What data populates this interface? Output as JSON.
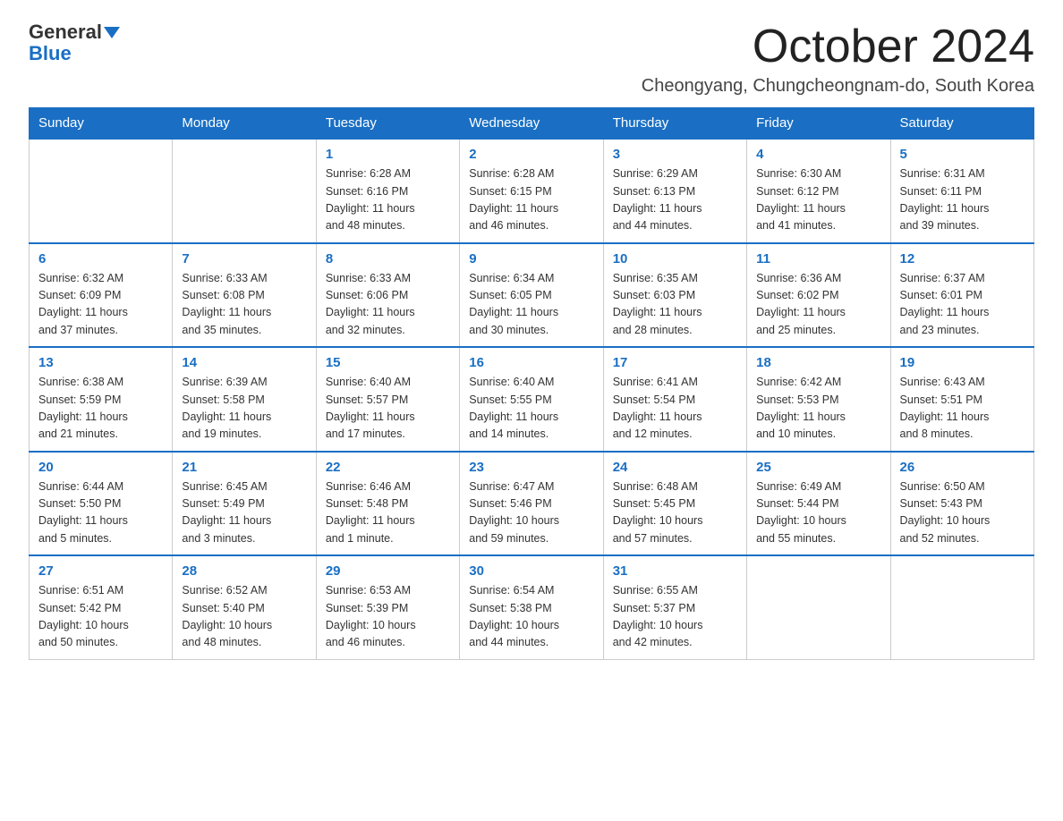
{
  "header": {
    "logo_general": "General",
    "logo_blue": "Blue",
    "month_title": "October 2024",
    "location": "Cheongyang, Chungcheongnam-do, South Korea"
  },
  "days_of_week": [
    "Sunday",
    "Monday",
    "Tuesday",
    "Wednesday",
    "Thursday",
    "Friday",
    "Saturday"
  ],
  "weeks": [
    [
      {
        "day": "",
        "info": ""
      },
      {
        "day": "",
        "info": ""
      },
      {
        "day": "1",
        "info": "Sunrise: 6:28 AM\nSunset: 6:16 PM\nDaylight: 11 hours\nand 48 minutes."
      },
      {
        "day": "2",
        "info": "Sunrise: 6:28 AM\nSunset: 6:15 PM\nDaylight: 11 hours\nand 46 minutes."
      },
      {
        "day": "3",
        "info": "Sunrise: 6:29 AM\nSunset: 6:13 PM\nDaylight: 11 hours\nand 44 minutes."
      },
      {
        "day": "4",
        "info": "Sunrise: 6:30 AM\nSunset: 6:12 PM\nDaylight: 11 hours\nand 41 minutes."
      },
      {
        "day": "5",
        "info": "Sunrise: 6:31 AM\nSunset: 6:11 PM\nDaylight: 11 hours\nand 39 minutes."
      }
    ],
    [
      {
        "day": "6",
        "info": "Sunrise: 6:32 AM\nSunset: 6:09 PM\nDaylight: 11 hours\nand 37 minutes."
      },
      {
        "day": "7",
        "info": "Sunrise: 6:33 AM\nSunset: 6:08 PM\nDaylight: 11 hours\nand 35 minutes."
      },
      {
        "day": "8",
        "info": "Sunrise: 6:33 AM\nSunset: 6:06 PM\nDaylight: 11 hours\nand 32 minutes."
      },
      {
        "day": "9",
        "info": "Sunrise: 6:34 AM\nSunset: 6:05 PM\nDaylight: 11 hours\nand 30 minutes."
      },
      {
        "day": "10",
        "info": "Sunrise: 6:35 AM\nSunset: 6:03 PM\nDaylight: 11 hours\nand 28 minutes."
      },
      {
        "day": "11",
        "info": "Sunrise: 6:36 AM\nSunset: 6:02 PM\nDaylight: 11 hours\nand 25 minutes."
      },
      {
        "day": "12",
        "info": "Sunrise: 6:37 AM\nSunset: 6:01 PM\nDaylight: 11 hours\nand 23 minutes."
      }
    ],
    [
      {
        "day": "13",
        "info": "Sunrise: 6:38 AM\nSunset: 5:59 PM\nDaylight: 11 hours\nand 21 minutes."
      },
      {
        "day": "14",
        "info": "Sunrise: 6:39 AM\nSunset: 5:58 PM\nDaylight: 11 hours\nand 19 minutes."
      },
      {
        "day": "15",
        "info": "Sunrise: 6:40 AM\nSunset: 5:57 PM\nDaylight: 11 hours\nand 17 minutes."
      },
      {
        "day": "16",
        "info": "Sunrise: 6:40 AM\nSunset: 5:55 PM\nDaylight: 11 hours\nand 14 minutes."
      },
      {
        "day": "17",
        "info": "Sunrise: 6:41 AM\nSunset: 5:54 PM\nDaylight: 11 hours\nand 12 minutes."
      },
      {
        "day": "18",
        "info": "Sunrise: 6:42 AM\nSunset: 5:53 PM\nDaylight: 11 hours\nand 10 minutes."
      },
      {
        "day": "19",
        "info": "Sunrise: 6:43 AM\nSunset: 5:51 PM\nDaylight: 11 hours\nand 8 minutes."
      }
    ],
    [
      {
        "day": "20",
        "info": "Sunrise: 6:44 AM\nSunset: 5:50 PM\nDaylight: 11 hours\nand 5 minutes."
      },
      {
        "day": "21",
        "info": "Sunrise: 6:45 AM\nSunset: 5:49 PM\nDaylight: 11 hours\nand 3 minutes."
      },
      {
        "day": "22",
        "info": "Sunrise: 6:46 AM\nSunset: 5:48 PM\nDaylight: 11 hours\nand 1 minute."
      },
      {
        "day": "23",
        "info": "Sunrise: 6:47 AM\nSunset: 5:46 PM\nDaylight: 10 hours\nand 59 minutes."
      },
      {
        "day": "24",
        "info": "Sunrise: 6:48 AM\nSunset: 5:45 PM\nDaylight: 10 hours\nand 57 minutes."
      },
      {
        "day": "25",
        "info": "Sunrise: 6:49 AM\nSunset: 5:44 PM\nDaylight: 10 hours\nand 55 minutes."
      },
      {
        "day": "26",
        "info": "Sunrise: 6:50 AM\nSunset: 5:43 PM\nDaylight: 10 hours\nand 52 minutes."
      }
    ],
    [
      {
        "day": "27",
        "info": "Sunrise: 6:51 AM\nSunset: 5:42 PM\nDaylight: 10 hours\nand 50 minutes."
      },
      {
        "day": "28",
        "info": "Sunrise: 6:52 AM\nSunset: 5:40 PM\nDaylight: 10 hours\nand 48 minutes."
      },
      {
        "day": "29",
        "info": "Sunrise: 6:53 AM\nSunset: 5:39 PM\nDaylight: 10 hours\nand 46 minutes."
      },
      {
        "day": "30",
        "info": "Sunrise: 6:54 AM\nSunset: 5:38 PM\nDaylight: 10 hours\nand 44 minutes."
      },
      {
        "day": "31",
        "info": "Sunrise: 6:55 AM\nSunset: 5:37 PM\nDaylight: 10 hours\nand 42 minutes."
      },
      {
        "day": "",
        "info": ""
      },
      {
        "day": "",
        "info": ""
      }
    ]
  ]
}
